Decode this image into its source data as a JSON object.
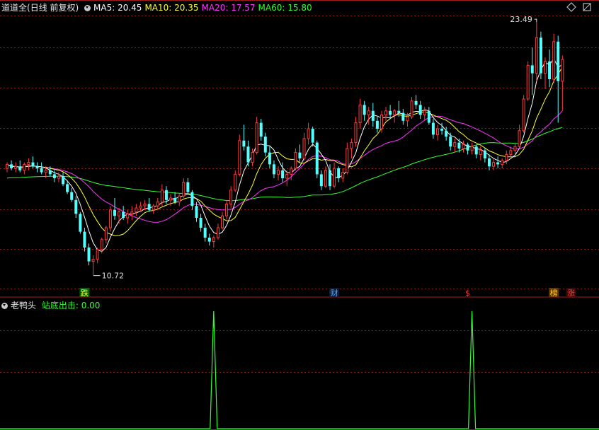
{
  "main_panel": {
    "stock_name": "道道全",
    "period_label": "(日线 前复权)",
    "ma_legend": [
      {
        "key": "MA5",
        "text": "MA5: 20.45",
        "color": "#ffffff"
      },
      {
        "key": "MA10",
        "text": "MA10: 20.35",
        "color": "#ffff33"
      },
      {
        "key": "MA20",
        "text": "MA20: 17.57",
        "color": "#ff33ff"
      },
      {
        "key": "MA60",
        "text": "MA60: 15.80",
        "color": "#33ff33"
      }
    ],
    "high_marker": "23.49",
    "low_marker": "10.72",
    "event_badges": [
      {
        "text": "跌",
        "color": "#ffff33",
        "bg": "#006600"
      },
      {
        "text": "财",
        "color": "#4da6ff",
        "bg": "#0a1a3a"
      },
      {
        "text": "$",
        "color": "#ff3333",
        "bg": "transparent"
      },
      {
        "text": "榜",
        "color": "#ffcc33",
        "bg": "#663300"
      },
      {
        "text": "涨",
        "color": "#ff3333",
        "bg": "#3a0a0a"
      }
    ]
  },
  "indicator_panel": {
    "name": "老鸭头",
    "signal_text": "站底出击: 0.00"
  },
  "icons": [
    "collapse-triangle-icon",
    "diamond-nav-icon",
    "fullscreen-icon"
  ],
  "colors": {
    "up": "#ff3b3b",
    "down": "#54ffff",
    "grid": "#8b1a1a",
    "ma5": "#ffffff",
    "ma10": "#ffff33",
    "ma20": "#ff33ff",
    "ma60": "#33ff33",
    "signal": "#33ff33"
  },
  "chart_data": [
    {
      "type": "candlestick",
      "title": "道道全 (日线 前复权)",
      "candles": [
        [
          16.1,
          16.4,
          15.9,
          16.3
        ],
        [
          16.3,
          16.5,
          16.0,
          16.1
        ],
        [
          16.1,
          16.4,
          15.9,
          16.2
        ],
        [
          16.2,
          16.5,
          15.9,
          16.0
        ],
        [
          16.0,
          16.4,
          15.8,
          16.3
        ],
        [
          16.3,
          16.6,
          16.0,
          16.4
        ],
        [
          16.4,
          16.7,
          16.1,
          16.2
        ],
        [
          16.2,
          16.4,
          15.9,
          16.1
        ],
        [
          16.1,
          16.4,
          15.8,
          15.9
        ],
        [
          15.9,
          16.2,
          15.6,
          16.0
        ],
        [
          16.0,
          16.2,
          15.7,
          15.8
        ],
        [
          15.8,
          16.0,
          15.4,
          15.6
        ],
        [
          15.6,
          15.9,
          15.4,
          15.7
        ],
        [
          15.7,
          15.9,
          15.2,
          15.3
        ],
        [
          15.3,
          15.5,
          14.8,
          14.9
        ],
        [
          14.9,
          15.1,
          14.4,
          14.5
        ],
        [
          14.5,
          14.7,
          13.6,
          13.8
        ],
        [
          13.8,
          13.9,
          12.8,
          12.9
        ],
        [
          12.9,
          13.1,
          11.9,
          12.1
        ],
        [
          12.1,
          12.3,
          11.2,
          11.4
        ],
        [
          11.4,
          11.7,
          10.72,
          11.5
        ],
        [
          11.5,
          12.1,
          11.3,
          12.0
        ],
        [
          12.0,
          12.6,
          11.8,
          12.5
        ],
        [
          12.5,
          13.2,
          12.3,
          13.1
        ],
        [
          13.1,
          14.2,
          12.9,
          14.0
        ],
        [
          14.0,
          14.6,
          13.5,
          13.7
        ],
        [
          13.7,
          14.1,
          13.3,
          13.9
        ],
        [
          13.9,
          14.2,
          13.5,
          13.6
        ],
        [
          13.6,
          14.0,
          13.3,
          13.8
        ],
        [
          13.8,
          14.2,
          13.5,
          13.9
        ],
        [
          13.9,
          14.3,
          13.7,
          14.1
        ],
        [
          14.1,
          14.4,
          13.9,
          14.2
        ],
        [
          14.2,
          14.5,
          14.0,
          14.3
        ],
        [
          14.3,
          14.6,
          13.9,
          14.0
        ],
        [
          14.0,
          14.3,
          13.8,
          14.2
        ],
        [
          14.2,
          14.6,
          14.0,
          14.4
        ],
        [
          14.4,
          15.3,
          14.2,
          15.0
        ],
        [
          15.0,
          15.2,
          14.3,
          14.5
        ],
        [
          14.5,
          14.8,
          14.2,
          14.6
        ],
        [
          14.6,
          14.9,
          14.3,
          14.4
        ],
        [
          14.4,
          14.8,
          14.2,
          14.7
        ],
        [
          14.7,
          15.6,
          14.6,
          15.4
        ],
        [
          15.4,
          15.6,
          14.8,
          14.9
        ],
        [
          14.9,
          15.0,
          14.0,
          14.2
        ],
        [
          14.2,
          14.4,
          13.4,
          13.6
        ],
        [
          13.6,
          13.8,
          12.9,
          13.1
        ],
        [
          13.1,
          13.3,
          12.4,
          12.6
        ],
        [
          12.6,
          12.8,
          12.2,
          12.4
        ],
        [
          12.4,
          12.7,
          12.1,
          12.6
        ],
        [
          12.6,
          13.3,
          12.5,
          13.1
        ],
        [
          13.1,
          13.9,
          13.0,
          13.7
        ],
        [
          13.7,
          14.5,
          13.5,
          14.3
        ],
        [
          14.3,
          15.2,
          14.1,
          15.0
        ],
        [
          15.0,
          16.0,
          14.9,
          15.8
        ],
        [
          15.8,
          17.8,
          15.7,
          17.5
        ],
        [
          17.5,
          18.3,
          17.0,
          17.2
        ],
        [
          17.2,
          17.5,
          16.2,
          16.4
        ],
        [
          16.4,
          17.1,
          16.2,
          16.9
        ],
        [
          16.9,
          18.7,
          16.8,
          18.4
        ],
        [
          18.4,
          18.6,
          17.5,
          17.7
        ],
        [
          17.7,
          17.9,
          16.7,
          16.9
        ],
        [
          16.9,
          17.2,
          16.1,
          16.3
        ],
        [
          16.3,
          16.5,
          15.6,
          15.8
        ],
        [
          15.8,
          16.2,
          15.5,
          16.0
        ],
        [
          16.0,
          16.4,
          15.4,
          15.6
        ],
        [
          15.6,
          16.0,
          15.2,
          15.8
        ],
        [
          15.8,
          16.2,
          15.5,
          16.1
        ],
        [
          16.1,
          17.1,
          16.0,
          16.9
        ],
        [
          16.9,
          17.3,
          16.4,
          16.6
        ],
        [
          16.6,
          17.9,
          16.5,
          17.6
        ],
        [
          17.6,
          18.4,
          17.3,
          18.1
        ],
        [
          18.1,
          18.2,
          17.2,
          17.4
        ],
        [
          17.4,
          17.5,
          15.6,
          15.8
        ],
        [
          15.8,
          16.0,
          15.0,
          15.2
        ],
        [
          15.2,
          16.2,
          15.1,
          16.0
        ],
        [
          16.0,
          16.3,
          15.0,
          15.2
        ],
        [
          15.2,
          16.4,
          15.1,
          16.1
        ],
        [
          16.1,
          16.2,
          15.4,
          15.6
        ],
        [
          15.6,
          16.1,
          15.4,
          15.9
        ],
        [
          15.9,
          17.4,
          15.8,
          17.1
        ],
        [
          17.1,
          17.6,
          16.6,
          17.4
        ],
        [
          17.4,
          18.7,
          17.2,
          18.4
        ],
        [
          18.4,
          19.6,
          18.1,
          19.3
        ],
        [
          19.3,
          19.5,
          18.5,
          18.8
        ],
        [
          18.8,
          19.2,
          18.3,
          19.0
        ],
        [
          19.0,
          19.4,
          18.2,
          18.5
        ],
        [
          18.5,
          18.7,
          17.9,
          18.1
        ],
        [
          18.1,
          19.0,
          17.9,
          18.8
        ],
        [
          18.8,
          19.2,
          18.5,
          19.0
        ],
        [
          19.0,
          19.3,
          18.6,
          18.8
        ],
        [
          18.8,
          19.1,
          18.4,
          19.0
        ],
        [
          19.0,
          19.5,
          18.7,
          18.9
        ],
        [
          18.9,
          19.1,
          18.3,
          18.5
        ],
        [
          18.5,
          18.9,
          18.2,
          18.7
        ],
        [
          18.7,
          19.7,
          18.6,
          19.5
        ],
        [
          19.5,
          19.8,
          19.1,
          19.3
        ],
        [
          19.3,
          19.5,
          18.6,
          18.8
        ],
        [
          18.8,
          19.2,
          18.5,
          19.0
        ],
        [
          19.0,
          19.2,
          18.3,
          18.4
        ],
        [
          18.4,
          18.6,
          17.6,
          17.8
        ],
        [
          17.8,
          18.3,
          17.5,
          18.1
        ],
        [
          18.1,
          18.4,
          17.8,
          18.0
        ],
        [
          18.0,
          18.2,
          17.5,
          17.7
        ],
        [
          17.7,
          17.9,
          17.0,
          17.2
        ],
        [
          17.2,
          17.6,
          16.9,
          17.4
        ],
        [
          17.4,
          17.6,
          16.9,
          17.1
        ],
        [
          17.1,
          17.5,
          16.9,
          17.3
        ],
        [
          17.3,
          17.4,
          16.8,
          17.0
        ],
        [
          17.0,
          17.4,
          16.8,
          17.2
        ],
        [
          17.2,
          17.3,
          16.6,
          16.8
        ],
        [
          16.8,
          17.2,
          16.5,
          17.0
        ],
        [
          17.0,
          17.1,
          16.4,
          16.6
        ],
        [
          16.6,
          16.8,
          16.0,
          16.2
        ],
        [
          16.2,
          16.6,
          16.0,
          16.4
        ],
        [
          16.4,
          16.7,
          16.1,
          16.3
        ],
        [
          16.3,
          16.6,
          16.1,
          16.5
        ],
        [
          16.5,
          17.0,
          16.3,
          16.8
        ],
        [
          16.8,
          17.2,
          16.6,
          17.0
        ],
        [
          17.0,
          17.4,
          16.8,
          17.2
        ],
        [
          17.2,
          18.3,
          17.1,
          18.0
        ],
        [
          18.0,
          19.8,
          17.9,
          19.6
        ],
        [
          19.6,
          21.5,
          19.5,
          21.3
        ],
        [
          21.3,
          22.2,
          19.8,
          20.9
        ],
        [
          20.9,
          23.49,
          20.5,
          22.7
        ],
        [
          22.7,
          23.0,
          20.6,
          20.9
        ],
        [
          20.9,
          21.7,
          20.1,
          21.5
        ],
        [
          21.5,
          22.1,
          20.2,
          20.6
        ],
        [
          20.6,
          22.9,
          20.4,
          22.5
        ],
        [
          22.5,
          22.8,
          18.4,
          20.5
        ],
        [
          20.5,
          21.8,
          19.0,
          21.6
        ]
      ],
      "ma_series": [
        "MA5",
        "MA10",
        "MA20",
        "MA60"
      ],
      "price_high": 23.49,
      "price_low": 10.72,
      "grid": true
    },
    {
      "type": "line",
      "title": "老鸭头",
      "series": [
        {
          "name": "站底出击",
          "spikes_at_candle_index": [
            48,
            108
          ],
          "spike_value": 1,
          "last_value": 0.0
        }
      ]
    }
  ]
}
